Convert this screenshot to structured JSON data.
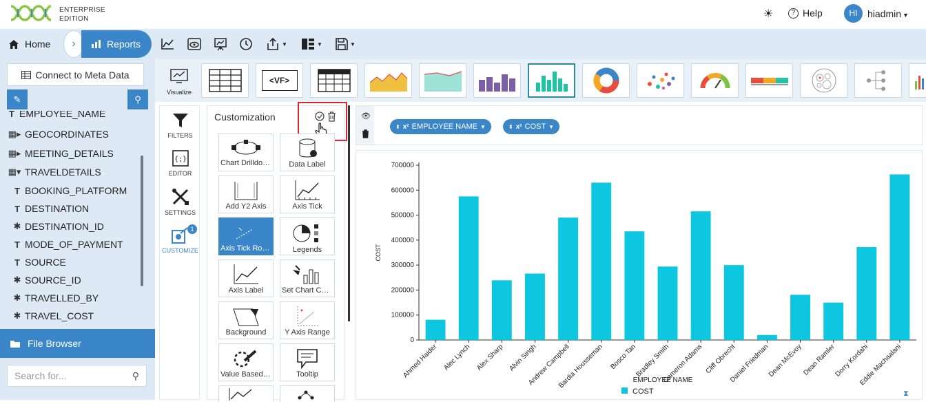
{
  "brand": {
    "line1": "ENTERPRISE",
    "line2": "EDITION"
  },
  "topbar": {
    "help_label": "Help",
    "avatar_initials": "HI",
    "user_name": "hiadmin"
  },
  "nav": {
    "home_label": "Home",
    "reports_label": "Reports"
  },
  "sidebar": {
    "connect_label": "Connect to Meta Data",
    "items": [
      {
        "label": "EMPLOYEE_NAME",
        "glyph": "T"
      },
      {
        "label": "GEOCORDINATES",
        "glyph": "▦▸"
      },
      {
        "label": "MEETING_DETAILS",
        "glyph": "▦▸"
      },
      {
        "label": "TRAVELDETAILS",
        "glyph": "▦▾"
      },
      {
        "label": "BOOKING_PLATFORM",
        "glyph": "T"
      },
      {
        "label": "DESTINATION",
        "glyph": "T"
      },
      {
        "label": "DESTINATION_ID",
        "glyph": "✱"
      },
      {
        "label": "MODE_OF_PAYMENT",
        "glyph": "T"
      },
      {
        "label": "SOURCE",
        "glyph": "T"
      },
      {
        "label": "SOURCE_ID",
        "glyph": "✱"
      },
      {
        "label": "TRAVELLED_BY",
        "glyph": "✱"
      },
      {
        "label": "TRAVEL_COST",
        "glyph": "✱"
      }
    ],
    "file_browser_label": "File Browser",
    "search_placeholder": "Search for..."
  },
  "viz": {
    "visualize_label": "Visualize",
    "vf_label": "<VF>"
  },
  "mininav": {
    "filters_label": "FILTERS",
    "editor_label": "EDITOR",
    "settings_label": "SETTINGS",
    "customize_label": "CUSTOMIZE",
    "badge": "1"
  },
  "customization": {
    "title": "Customization",
    "tiles": [
      "Chart Drilldown",
      "Data Label",
      "Add Y2 Axis",
      "Axis Tick",
      "Axis Tick Rotation",
      "Legends",
      "Axis Label",
      "Set Chart Color",
      "Background",
      "Y Axis Range",
      "Value Based Color",
      "Tooltip"
    ]
  },
  "fieldbar": {
    "pill_x": "EMPLOYEE NAME",
    "pill_y": "COST"
  },
  "colors": {
    "accent": "#3a86c8",
    "bar": "#0dc6df",
    "highlight": "#d8262f"
  },
  "chart_data": {
    "type": "bar",
    "xlabel": "EMPLOYEE NAME",
    "ylabel": "COST",
    "ylim": [
      0,
      700000
    ],
    "yticks": [
      "0",
      "100000",
      "200000",
      "300000",
      "400000",
      "500000",
      "600000",
      "700000"
    ],
    "categories": [
      "Ahmed Haider",
      "Alec Lynch",
      "Alex Sharp",
      "Alvin Singh",
      "Andrew Campbell",
      "Bardia Housseman",
      "Bosco Tan",
      "Bradley Smith",
      "Cameron Adams",
      "Cliff Obrecht",
      "Daniel Friedman",
      "Dean McEvoy",
      "Dean Ramler",
      "Dorry Kordahi",
      "Eddie Machaalani"
    ],
    "series": [
      {
        "name": "COST",
        "values": [
          81000,
          575000,
          239000,
          266000,
          490000,
          630000,
          435000,
          294000,
          515000,
          300000,
          20000,
          181000,
          150000,
          372000,
          663000
        ]
      }
    ],
    "legend": "bottom"
  }
}
